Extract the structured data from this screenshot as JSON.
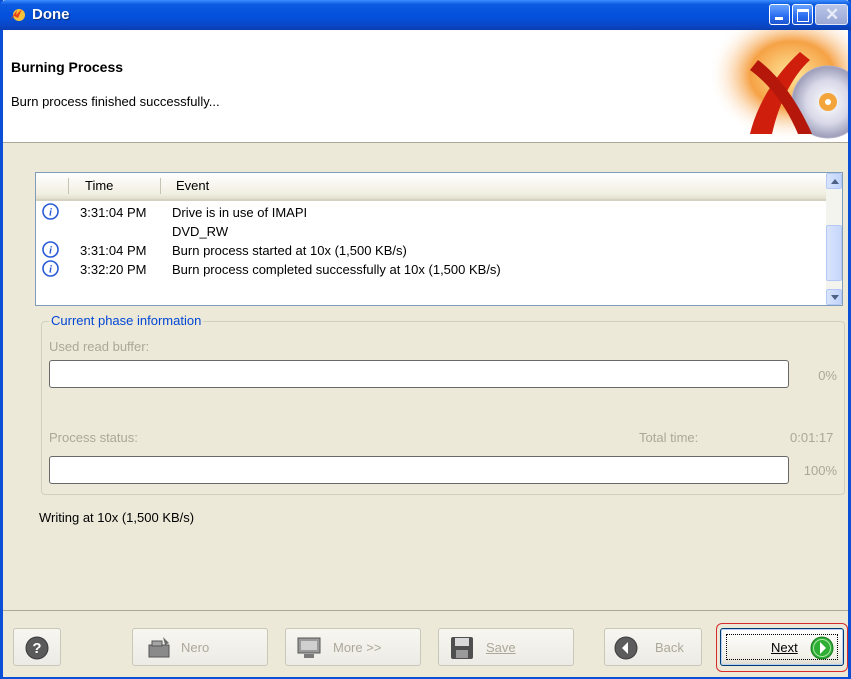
{
  "window": {
    "title": "Done"
  },
  "header": {
    "title": "Burning Process",
    "subtitle": "Burn process finished successfully..."
  },
  "log": {
    "columns": [
      "Time",
      "Event"
    ],
    "rows": [
      {
        "icon": "info-icon",
        "time": "3:31:04 PM",
        "event": "Drive is in use of IMAPI"
      },
      {
        "icon": "",
        "time": "",
        "event": "DVD_RW"
      },
      {
        "icon": "info-icon",
        "time": "3:31:04 PM",
        "event": "Burn process started at 10x (1,500 KB/s)"
      },
      {
        "icon": "info-icon",
        "time": "3:32:20 PM",
        "event": "Burn process completed successfully at 10x (1,500 KB/s)"
      }
    ]
  },
  "phase": {
    "group_label": "Current phase information",
    "buffer_label": "Used read buffer:",
    "buffer_percent": "0%",
    "buffer_value": 0,
    "status_label": "Process status:",
    "total_time_label": "Total time:",
    "total_time_value": "0:01:17",
    "status_percent": "100%",
    "status_value": 100
  },
  "status_line": "Writing at 10x (1,500 KB/s)",
  "buttons": {
    "help": "",
    "nero": "Nero",
    "more": "More >>",
    "save": "Save",
    "back": "Back",
    "next": "Next"
  },
  "colors": {
    "titlebar": "#0351dc",
    "group_label": "#0046d5",
    "disabled_text": "#aca899",
    "next_highlight": "#d62b2b",
    "next_arrow": "#2fae35"
  }
}
